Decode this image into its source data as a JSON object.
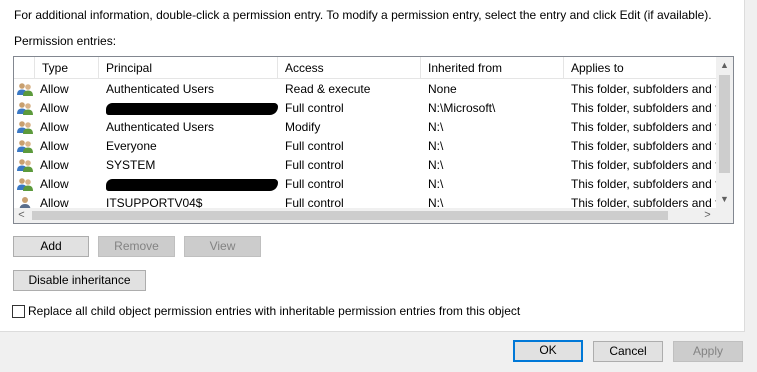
{
  "dialog": {
    "info_text": "For additional information, double-click a permission entry. To modify a permission entry, select the entry and click Edit (if available).",
    "entries_label": "Permission entries:"
  },
  "grid": {
    "columns": {
      "type": "Type",
      "principal": "Principal",
      "access": "Access",
      "inherited_from": "Inherited from",
      "applies_to": "Applies to"
    },
    "rows": [
      {
        "icon": "user-group-icon",
        "type": "Allow",
        "principal": "Authenticated Users",
        "access": "Read & execute",
        "inherited_from": "None",
        "applies_to": "This folder, subfolders and files"
      },
      {
        "icon": "user-group-icon",
        "type": "Allow",
        "principal": "",
        "access": "Full control",
        "inherited_from": "N:\\Microsoft\\",
        "applies_to": "This folder, subfolders and files"
      },
      {
        "icon": "user-group-icon",
        "type": "Allow",
        "principal": "Authenticated Users",
        "access": "Modify",
        "inherited_from": "N:\\",
        "applies_to": "This folder, subfolders and files"
      },
      {
        "icon": "user-group-icon",
        "type": "Allow",
        "principal": "Everyone",
        "access": "Full control",
        "inherited_from": "N:\\",
        "applies_to": "This folder, subfolders and files"
      },
      {
        "icon": "user-group-icon",
        "type": "Allow",
        "principal": "SYSTEM",
        "access": "Full control",
        "inherited_from": "N:\\",
        "applies_to": "This folder, subfolders and files"
      },
      {
        "icon": "user-group-icon",
        "type": "Allow",
        "principal": "",
        "access": "Full control",
        "inherited_from": "N:\\",
        "applies_to": "This folder, subfolders and files"
      },
      {
        "icon": "user-icon",
        "type": "Allow",
        "principal": "ITSUPPORTV04$",
        "access": "Full control",
        "inherited_from": "N:\\",
        "applies_to": "This folder, subfolders and files"
      }
    ]
  },
  "buttons": {
    "add": "Add",
    "remove": "Remove",
    "view": "View",
    "disable_inheritance": "Disable inheritance",
    "ok": "OK",
    "cancel": "Cancel",
    "apply": "Apply"
  },
  "replace_checkbox": {
    "label": "Replace all child object permission entries with inheritable permission entries from this object",
    "checked": false
  },
  "scroll_arrows": {
    "up": "▲",
    "down": "▼",
    "left": "<",
    "right": ">"
  },
  "colors": {
    "accent": "#0078d7",
    "window_bg": "#f0f0f0"
  }
}
